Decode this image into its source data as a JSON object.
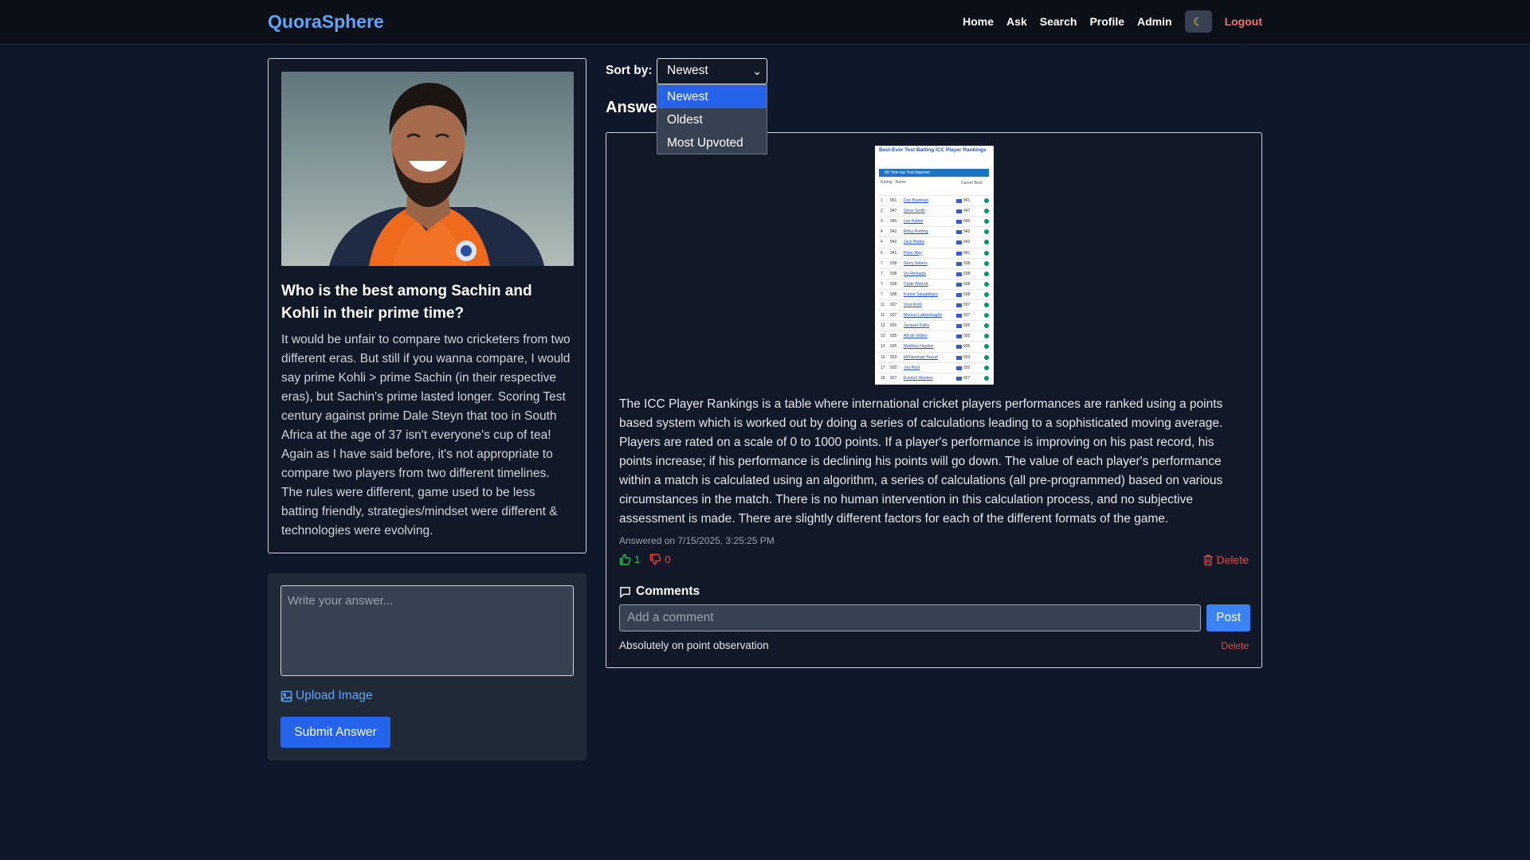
{
  "navbar": {
    "brand": "QuoraSphere",
    "links": [
      "Home",
      "Ask",
      "Search",
      "Profile",
      "Admin"
    ],
    "theme_icon": "moon-icon",
    "logout": "Logout"
  },
  "question": {
    "title": "Who is the best among Sachin and Kohli in their prime time?",
    "body": "It would be unfair to compare two cricketers from two different eras. But still if you wanna compare, I would say prime Kohli > prime Sachin (in their respective eras), but Sachin's prime lasted longer. Scoring Test century against prime Dale Steyn that too in South Africa at the age of 37 isn't everyone's cup of tea! Again as I have said before, it's not appropriate to compare two players from two different timelines. The rules were different, game used to be less batting friendly, strategies/mindset were different & technologies were evolving."
  },
  "answer_form": {
    "placeholder": "Write your answer...",
    "upload_label": "Upload Image",
    "submit_label": "Submit Answer"
  },
  "sort": {
    "label": "Sort by:",
    "selected": "Newest",
    "options": [
      "Newest",
      "Oldest",
      "Most Upvoted"
    ]
  },
  "answers_heading": "Answers",
  "answer": {
    "image": {
      "title": "Best-Ever Test Batting ICC Player Rankings",
      "bar_text": "All Time top Test batsmen",
      "col_rating": "Rating",
      "col_name": "Name",
      "col_career": "Career Best",
      "rows": [
        {
          "rank": "1",
          "pts": "961",
          "name": "Don Bradman",
          "best": "961"
        },
        {
          "rank": "2",
          "pts": "947",
          "name": "Steve Smith",
          "best": "947"
        },
        {
          "rank": "3",
          "pts": "945",
          "name": "Len Hutton",
          "best": "945"
        },
        {
          "rank": "4",
          "pts": "942",
          "name": "Ricky Ponting",
          "best": "942"
        },
        {
          "rank": "4",
          "pts": "942",
          "name": "Jack Hobbs",
          "best": "942"
        },
        {
          "rank": "6",
          "pts": "941",
          "name": "Peter May",
          "best": "941"
        },
        {
          "rank": "7",
          "pts": "938",
          "name": "Garry Sobers",
          "best": "938"
        },
        {
          "rank": "7",
          "pts": "938",
          "name": "Viv Richards",
          "best": "938"
        },
        {
          "rank": "7",
          "pts": "938",
          "name": "Clyde Walcott",
          "best": "938"
        },
        {
          "rank": "7",
          "pts": "938",
          "name": "Kumar Sangakkara",
          "best": "938"
        },
        {
          "rank": "11",
          "pts": "937",
          "name": "Virat Kohli",
          "best": "937"
        },
        {
          "rank": "11",
          "pts": "937",
          "name": "Marnus Labuschagne",
          "best": "937"
        },
        {
          "rank": "13",
          "pts": "935",
          "name": "Jacques Kallis",
          "best": "935"
        },
        {
          "rank": "13",
          "pts": "935",
          "name": "AB de Villiers",
          "best": "935"
        },
        {
          "rank": "13",
          "pts": "935",
          "name": "Matthew Hayden",
          "best": "935"
        },
        {
          "rank": "16",
          "pts": "933",
          "name": "Mohammad Yousuf",
          "best": "933"
        },
        {
          "rank": "17",
          "pts": "932",
          "name": "Joe Root",
          "best": "932"
        },
        {
          "rank": "18",
          "pts": "927",
          "name": "Everton Weekes",
          "best": "927"
        }
      ]
    },
    "body": "The ICC Player Rankings is a table where international cricket players performances are ranked using a points based system which is worked out by doing a series of calculations leading to a sophisticated moving average. Players are rated on a scale of 0 to 1000 points. If a player's performance is improving on his past record, his points increase; if his performance is declining his points will go down. The value of each player's performance within a match is calculated using an algorithm, a series of calculations (all pre-programmed) based on various circumstances in the match. There is no human intervention in this calculation process, and no subjective assessment is made. There are slightly different factors for each of the different formats of the game.",
    "meta": "Answered on 7/15/2025, 3:25:25 PM",
    "upvotes": "1",
    "downvotes": "0",
    "delete_label": "Delete",
    "comments_heading": "Comments",
    "comment_placeholder": "Add a comment",
    "post_label": "Post",
    "comments": [
      {
        "text": "Absolutely on point observation",
        "delete": "Delete"
      }
    ]
  },
  "colors": {
    "background": "#0f172a",
    "brand": "#60a5fa",
    "primary_button": "#2563eb",
    "danger": "#ef4444",
    "upvote": "#22c55e"
  }
}
